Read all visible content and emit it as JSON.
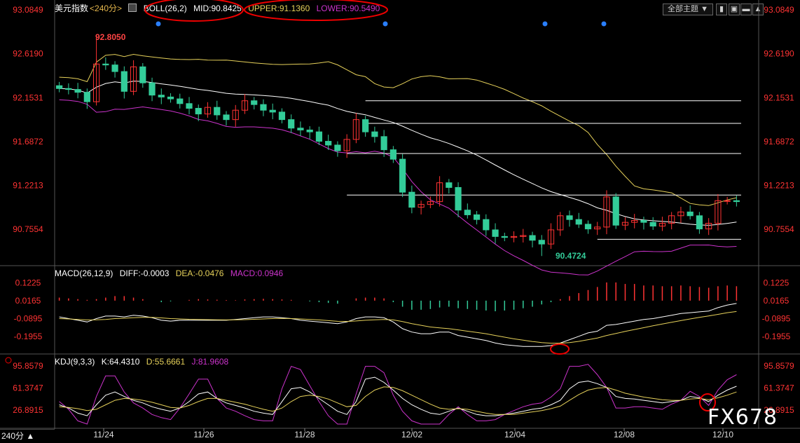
{
  "main": {
    "title": "美元指数",
    "period": "<240分>",
    "indicator": "BOLL(26,2)",
    "mid": "MID:90.8425",
    "upper": "UPPER:91.1360",
    "lower": "LOWER:90.5490",
    "high_label": "92.8050",
    "low_label": "90.4724"
  },
  "macd": {
    "title": "MACD(26,12,9)",
    "diff": "DIFF:-0.0003",
    "dea": "DEA:-0.0476",
    "macd": "MACD:0.0946"
  },
  "kdj": {
    "title": "KDJ(9,3,3)",
    "k": "K:64.4310",
    "d": "D:55.6661",
    "j": "J:81.9608"
  },
  "toolbar": {
    "theme_label": "全部主题",
    "period_badge": "240分"
  },
  "watermark": "FX678",
  "colors": {
    "up": "#ff3333",
    "down": "#33cc99",
    "mid": "#ffffff",
    "upper": "#e6d15a",
    "lower": "#cc33cc",
    "axis_text": "#ff3333"
  },
  "chart_data": [
    {
      "type": "candlestick",
      "title": "美元指数 <240分>",
      "y_ticks": [
        "93.0849",
        "92.6190",
        "92.1531",
        "91.6872",
        "91.2213",
        "90.7554"
      ],
      "ylim": [
        90.4,
        93.1
      ],
      "x_ticks": [
        "11/24",
        "11/26",
        "11/28",
        "12/02",
        "12/04",
        "12/08",
        "12/10"
      ],
      "high": 92.805,
      "low": 90.4724,
      "close": [
        92.25,
        92.24,
        92.21,
        92.11,
        92.51,
        92.5,
        92.43,
        92.22,
        92.48,
        92.31,
        92.18,
        92.16,
        92.14,
        92.09,
        92.04,
        91.98,
        92.05,
        91.97,
        91.92,
        92.02,
        92.12,
        92.08,
        92.02,
        92.0,
        91.92,
        91.83,
        91.81,
        91.79,
        91.69,
        91.65,
        91.59,
        91.71,
        91.92,
        91.79,
        91.74,
        91.6,
        91.5,
        91.15,
        90.99,
        91.02,
        91.05,
        91.25,
        91.2,
        90.96,
        90.91,
        90.86,
        90.75,
        90.68,
        90.67,
        90.68,
        90.69,
        90.64,
        90.6,
        90.75,
        90.9,
        90.86,
        90.81,
        90.76,
        90.78,
        91.1,
        90.8,
        90.83,
        90.85,
        90.83,
        90.79,
        90.82,
        90.9,
        90.94,
        90.9,
        90.76,
        90.82,
        91.06,
        91.06,
        91.05
      ],
      "series": [
        {
          "name": "MID",
          "value": 90.8425
        },
        {
          "name": "UPPER",
          "value": 91.136
        },
        {
          "name": "LOWER",
          "value": 90.549
        }
      ],
      "h_lines": [
        92.12,
        91.88,
        91.56,
        91.12,
        90.65
      ]
    },
    {
      "type": "bar",
      "title": "MACD(26,12,9)",
      "y_ticks": [
        "0.1225",
        "0.0165",
        "-0.0895",
        "-0.1955"
      ],
      "ylim": [
        -0.3,
        0.17
      ],
      "values": [
        0.02,
        0.015,
        0.01,
        0.005,
        0.01,
        0.02,
        0.03,
        0.03,
        0.02,
        0.01,
        0.0,
        -0.01,
        -0.005,
        0.0,
        0.005,
        0.01,
        0.008,
        0.006,
        0.004,
        0.003,
        0.008,
        0.01,
        0.012,
        0.01,
        0.008,
        0.005,
        0.0,
        -0.005,
        -0.01,
        -0.015,
        -0.02,
        0.0,
        0.015,
        0.02,
        0.02,
        0.015,
        -0.01,
        -0.04,
        -0.06,
        -0.06,
        -0.055,
        -0.045,
        -0.04,
        -0.05,
        -0.055,
        -0.06,
        -0.065,
        -0.07,
        -0.065,
        -0.06,
        -0.05,
        -0.04,
        -0.025,
        -0.01,
        0.01,
        0.03,
        0.05,
        0.07,
        0.09,
        0.12,
        0.12,
        0.11,
        0.11,
        0.1,
        0.1,
        0.095,
        0.095,
        0.1,
        0.095,
        0.09,
        0.085,
        0.095,
        0.1,
        0.095
      ],
      "diff": [
        -0.08,
        -0.09,
        -0.1,
        -0.11,
        -0.09,
        -0.075,
        -0.075,
        -0.08,
        -0.07,
        -0.075,
        -0.085,
        -0.1,
        -0.105,
        -0.1,
        -0.1,
        -0.1,
        -0.1,
        -0.1,
        -0.1,
        -0.095,
        -0.09,
        -0.085,
        -0.08,
        -0.08,
        -0.085,
        -0.09,
        -0.1,
        -0.105,
        -0.11,
        -0.115,
        -0.12,
        -0.11,
        -0.09,
        -0.08,
        -0.08,
        -0.085,
        -0.11,
        -0.15,
        -0.17,
        -0.18,
        -0.18,
        -0.17,
        -0.17,
        -0.19,
        -0.2,
        -0.21,
        -0.22,
        -0.235,
        -0.245,
        -0.25,
        -0.255,
        -0.255,
        -0.255,
        -0.25,
        -0.235,
        -0.215,
        -0.195,
        -0.175,
        -0.165,
        -0.13,
        -0.125,
        -0.115,
        -0.105,
        -0.095,
        -0.09,
        -0.08,
        -0.07,
        -0.06,
        -0.055,
        -0.05,
        -0.045,
        -0.025,
        -0.01,
        0.0
      ],
      "dea": [
        -0.09,
        -0.092,
        -0.095,
        -0.098,
        -0.097,
        -0.095,
        -0.09,
        -0.088,
        -0.085,
        -0.083,
        -0.083,
        -0.086,
        -0.09,
        -0.092,
        -0.094,
        -0.095,
        -0.096,
        -0.097,
        -0.098,
        -0.097,
        -0.096,
        -0.094,
        -0.092,
        -0.09,
        -0.089,
        -0.09,
        -0.092,
        -0.095,
        -0.098,
        -0.102,
        -0.106,
        -0.107,
        -0.104,
        -0.1,
        -0.097,
        -0.095,
        -0.098,
        -0.108,
        -0.12,
        -0.13,
        -0.14,
        -0.145,
        -0.15,
        -0.157,
        -0.165,
        -0.172,
        -0.18,
        -0.19,
        -0.2,
        -0.21,
        -0.218,
        -0.226,
        -0.232,
        -0.236,
        -0.236,
        -0.232,
        -0.225,
        -0.215,
        -0.205,
        -0.19,
        -0.178,
        -0.166,
        -0.155,
        -0.144,
        -0.133,
        -0.122,
        -0.112,
        -0.102,
        -0.092,
        -0.083,
        -0.074,
        -0.065,
        -0.055,
        -0.048
      ]
    },
    {
      "type": "line",
      "title": "KDJ(9,3,3)",
      "y_ticks": [
        "95.8579",
        "61.3747",
        "26.8915"
      ],
      "ylim": [
        5,
        100
      ],
      "k": [
        35,
        30,
        22,
        18,
        35,
        50,
        55,
        48,
        42,
        38,
        32,
        28,
        25,
        30,
        40,
        52,
        55,
        45,
        38,
        34,
        30,
        25,
        22,
        20,
        40,
        60,
        62,
        55,
        45,
        35,
        25,
        20,
        40,
        75,
        78,
        70,
        58,
        45,
        35,
        28,
        22,
        20,
        25,
        30,
        25,
        20,
        18,
        18,
        20,
        22,
        25,
        28,
        30,
        35,
        42,
        60,
        70,
        72,
        68,
        62,
        48,
        45,
        44,
        42,
        40,
        38,
        40,
        42,
        48,
        46,
        40,
        50,
        58,
        64
      ],
      "d": [
        32,
        31,
        29,
        26,
        28,
        35,
        42,
        45,
        44,
        42,
        39,
        35,
        31,
        30,
        34,
        40,
        45,
        45,
        42,
        39,
        36,
        32,
        28,
        25,
        30,
        40,
        48,
        50,
        48,
        44,
        38,
        32,
        34,
        48,
        58,
        63,
        62,
        57,
        50,
        43,
        36,
        30,
        28,
        29,
        28,
        25,
        22,
        20,
        20,
        20,
        22,
        24,
        26,
        29,
        33,
        42,
        51,
        58,
        61,
        62,
        58,
        53,
        50,
        47,
        45,
        43,
        42,
        42,
        44,
        45,
        43,
        46,
        50,
        55
      ],
      "j": [
        40,
        28,
        10,
        5,
        48,
        80,
        80,
        55,
        38,
        30,
        20,
        15,
        12,
        30,
        52,
        75,
        75,
        45,
        30,
        25,
        18,
        12,
        10,
        10,
        60,
        95,
        90,
        65,
        40,
        18,
        5,
        5,
        52,
        95,
        95,
        85,
        50,
        25,
        10,
        5,
        5,
        5,
        20,
        32,
        20,
        10,
        10,
        12,
        20,
        26,
        32,
        36,
        38,
        47,
        60,
        95,
        95,
        98,
        82,
        62,
        30,
        30,
        32,
        32,
        30,
        28,
        36,
        42,
        56,
        48,
        34,
        58,
        74,
        82
      ]
    }
  ]
}
